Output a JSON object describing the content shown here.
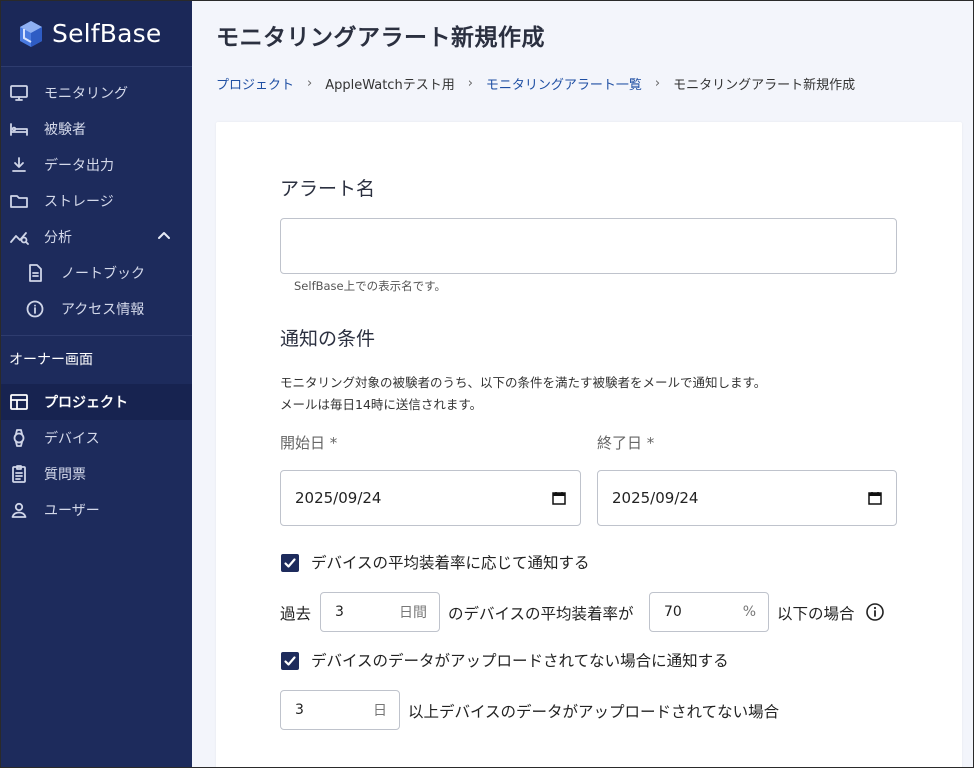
{
  "brand": {
    "name": "SelfBase"
  },
  "sidebar": {
    "items": [
      {
        "label": "モニタリング",
        "icon": "monitor-icon"
      },
      {
        "label": "被験者",
        "icon": "bed-icon"
      },
      {
        "label": "データ出力",
        "icon": "download-icon"
      },
      {
        "label": "ストレージ",
        "icon": "folder-icon"
      },
      {
        "label": "分析",
        "icon": "analytics-icon"
      },
      {
        "label": "ノートブック",
        "icon": "document-icon"
      },
      {
        "label": "アクセス情報",
        "icon": "info-icon"
      }
    ],
    "owner_section": "オーナー画面",
    "owner_items": [
      {
        "label": "プロジェクト",
        "icon": "table-icon",
        "active": true
      },
      {
        "label": "デバイス",
        "icon": "watch-icon"
      },
      {
        "label": "質問票",
        "icon": "clipboard-icon"
      },
      {
        "label": "ユーザー",
        "icon": "person-icon"
      }
    ]
  },
  "page": {
    "title": "モニタリングアラート新規作成"
  },
  "breadcrumb": {
    "items": [
      "プロジェクト",
      "AppleWatchテスト用",
      "モニタリングアラート一覧",
      "モニタリングアラート新規作成"
    ]
  },
  "form": {
    "alert_name": {
      "section_title": "アラート名",
      "value": "",
      "helper": "SelfBase上での表示名です。"
    },
    "conditions": {
      "section_title": "通知の条件",
      "desc_line1": "モニタリング対象の被験者のうち、以下の条件を満たす被験者をメールで通知します。",
      "desc_line2": "メールは毎日14時に送信されます。",
      "start_label": "開始日 *",
      "start_value": "2025/09/24",
      "end_label": "終了日 *",
      "end_value": "2025/09/24",
      "wear_check_label": "デバイスの平均装着率に応じて通知する",
      "wear_checked": true,
      "past_label": "過去",
      "days_value": "3",
      "days_unit": "日間",
      "wear_mid_label": "のデバイスの平均装着率が",
      "rate_value": "70",
      "rate_unit": "%",
      "wear_end_label": "以下の場合",
      "upload_check_label": "デバイスのデータがアップロードされてない場合に通知する",
      "upload_checked": true,
      "upload_days_value": "3",
      "upload_days_unit": "日",
      "upload_end_label": "以上デバイスのデータがアップロードされてない場合"
    }
  },
  "colors": {
    "sidebar_bg": "#1d2b5c",
    "accent": "#1f4fa3",
    "page_bg": "#f3f5fb"
  }
}
